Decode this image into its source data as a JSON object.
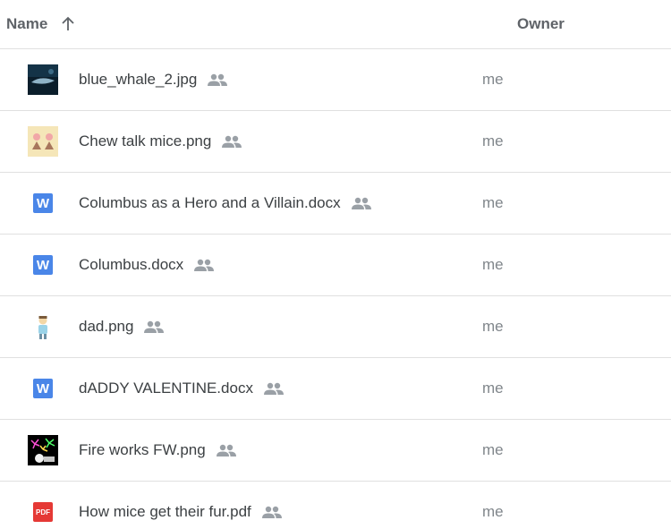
{
  "header": {
    "name_label": "Name",
    "owner_label": "Owner",
    "sort_direction": "ascending"
  },
  "files": [
    {
      "name": "blue_whale_2.jpg",
      "owner": "me",
      "icon": "image-thumbnail-whale-icon",
      "shared": true
    },
    {
      "name": "Chew talk mice.png",
      "owner": "me",
      "icon": "image-thumbnail-mice-icon",
      "shared": true
    },
    {
      "name": "Columbus as a Hero and a Villain.docx",
      "owner": "me",
      "icon": "word-doc-icon",
      "icon_label": "W",
      "shared": true
    },
    {
      "name": "Columbus.docx",
      "owner": "me",
      "icon": "word-doc-icon",
      "icon_label": "W",
      "shared": true
    },
    {
      "name": "dad.png",
      "owner": "me",
      "icon": "image-thumbnail-dad-icon",
      "shared": true
    },
    {
      "name": "dADDY VALENTINE.docx",
      "owner": "me",
      "icon": "word-doc-icon",
      "icon_label": "W",
      "shared": true
    },
    {
      "name": "Fire works FW.png",
      "owner": "me",
      "icon": "image-thumbnail-fireworks-icon",
      "shared": true
    },
    {
      "name": "How mice get their fur.pdf",
      "owner": "me",
      "icon": "pdf-icon",
      "icon_label": "PDF",
      "shared": true
    }
  ],
  "colors": {
    "word": "#4a86e8",
    "pdf": "#e53935",
    "text": "#3c4043",
    "muted": "#80868b",
    "divider": "#e0e0e0"
  }
}
